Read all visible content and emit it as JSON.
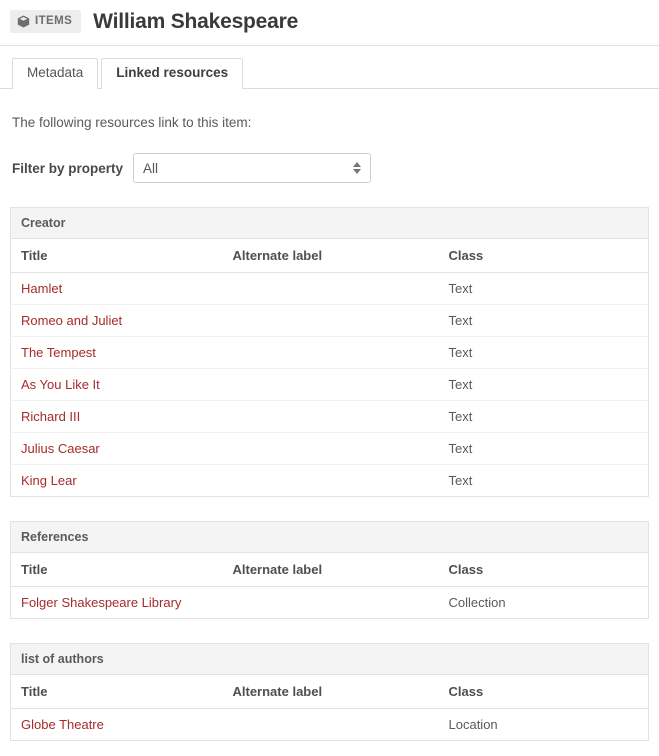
{
  "header": {
    "badge_label": "ITEMS",
    "badge_icon": "cube-icon",
    "title": "William Shakespeare"
  },
  "tabs": [
    {
      "label": "Metadata",
      "active": false
    },
    {
      "label": "Linked resources",
      "active": true
    }
  ],
  "main": {
    "intro_text": "The following resources link to this item:",
    "filter": {
      "label": "Filter by property",
      "selected_value": "All"
    },
    "columns": [
      "Title",
      "Alternate label",
      "Class"
    ],
    "property_blocks": [
      {
        "property": "Creator",
        "rows": [
          {
            "title": "Hamlet",
            "alternate_label": "",
            "class": "Text"
          },
          {
            "title": "Romeo and Juliet",
            "alternate_label": "",
            "class": "Text"
          },
          {
            "title": "The Tempest",
            "alternate_label": "",
            "class": "Text"
          },
          {
            "title": "As You Like It",
            "alternate_label": "",
            "class": "Text"
          },
          {
            "title": "Richard III",
            "alternate_label": "",
            "class": "Text"
          },
          {
            "title": "Julius Caesar",
            "alternate_label": "",
            "class": "Text"
          },
          {
            "title": "King Lear",
            "alternate_label": "",
            "class": "Text"
          }
        ]
      },
      {
        "property": "References",
        "rows": [
          {
            "title": "Folger Shakespeare Library",
            "alternate_label": "",
            "class": "Collection"
          }
        ]
      },
      {
        "property": "list of authors",
        "rows": [
          {
            "title": "Globe Theatre",
            "alternate_label": "",
            "class": "Location"
          }
        ]
      }
    ]
  },
  "colors": {
    "link": "#a62b2b",
    "badge_background": "#ededed",
    "block_header_background": "#f4f4f4",
    "border": "#e2e2e2",
    "text": "#4a4a4a"
  }
}
